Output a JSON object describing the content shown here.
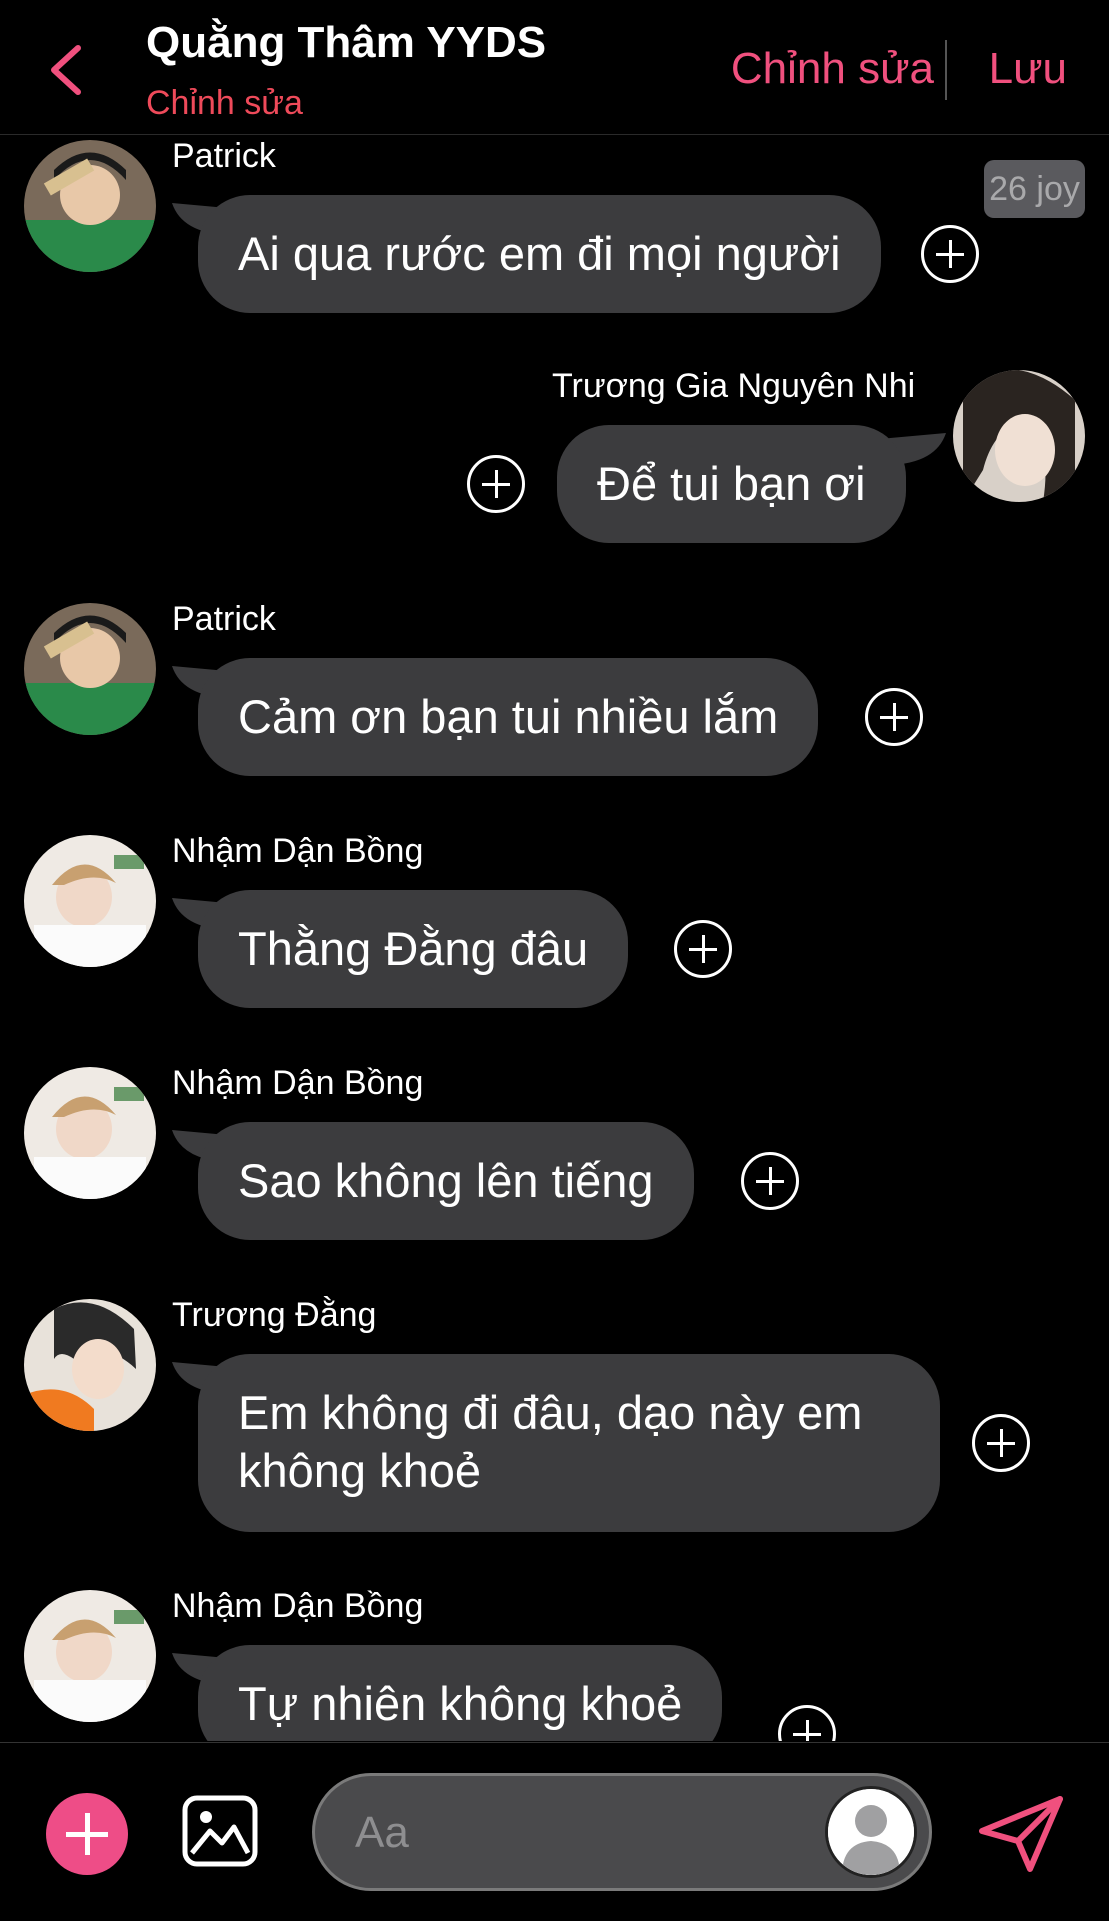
{
  "header": {
    "title": "Quằng Thâm YYDS",
    "subtitle": "Chỉnh sửa",
    "edit_label": "Chỉnh sửa",
    "save_label": "Lưu"
  },
  "badge": {
    "text": "26 joy"
  },
  "messages": [
    {
      "sender": "Patrick",
      "text": "Ai qua rước em đi mọi người",
      "side": "left",
      "avatar": "Patrick"
    },
    {
      "sender": "Trương Gia Nguyên Nhi",
      "text": "Để tui bạn ơi",
      "side": "right",
      "avatar": "Trương Gia Nguyên Nhi"
    },
    {
      "sender": "Patrick",
      "text": "Cảm ơn bạn tui nhiều lắm",
      "side": "left",
      "avatar": "Patrick"
    },
    {
      "sender": "Nhậm Dận Bồng",
      "text": "Thằng Đằng đâu",
      "side": "left",
      "avatar": "Nhậm Dận Bồng"
    },
    {
      "sender": "Nhậm Dận Bồng",
      "text": "Sao không lên tiếng",
      "side": "left",
      "avatar": "Nhậm Dận Bồng"
    },
    {
      "sender": "Trương Đằng",
      "text": "Em không đi đâu, dạo này em không khoẻ",
      "side": "left",
      "avatar": "Trương Đằng"
    },
    {
      "sender": "Nhậm Dận Bồng",
      "text": "Tự nhiên không khoẻ",
      "side": "left",
      "avatar": "Nhậm Dận Bồng"
    }
  ],
  "composer": {
    "placeholder": "Aa"
  },
  "colors": {
    "accent": "#f0507e",
    "subtitle": "#ee4a5a",
    "bubble": "#3c3c3e",
    "background": "#000000"
  },
  "icons": [
    "back-chevron-icon",
    "add-reaction-icon",
    "image-icon",
    "user-avatar-icon",
    "send-icon"
  ]
}
